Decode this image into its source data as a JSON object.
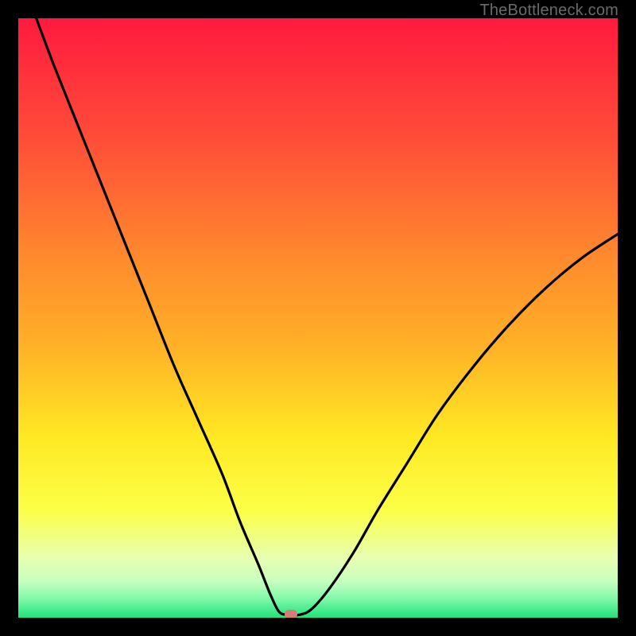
{
  "watermark": "TheBottleneck.com",
  "colors": {
    "frame": "#000000",
    "curve": "#000000",
    "marker": "#d87b74",
    "gradient_stops": [
      {
        "offset": 0.0,
        "color": "#ff1a3f"
      },
      {
        "offset": 0.2,
        "color": "#ff4d38"
      },
      {
        "offset": 0.4,
        "color": "#ff8a2d"
      },
      {
        "offset": 0.55,
        "color": "#ffb227"
      },
      {
        "offset": 0.7,
        "color": "#ffe924"
      },
      {
        "offset": 0.82,
        "color": "#fcff47"
      },
      {
        "offset": 0.9,
        "color": "#e8ffb0"
      },
      {
        "offset": 0.94,
        "color": "#c6ffc0"
      },
      {
        "offset": 0.97,
        "color": "#7cf7a6"
      },
      {
        "offset": 1.0,
        "color": "#1ee27d"
      }
    ]
  },
  "chart_data": {
    "type": "line",
    "title": "",
    "xlabel": "",
    "ylabel": "",
    "xlim": [
      0,
      100
    ],
    "ylim": [
      0,
      100
    ],
    "series": [
      {
        "name": "bottleneck-curve",
        "x": [
          3,
          6,
          10,
          14,
          18,
          22,
          26,
          30,
          34,
          37,
          40,
          42,
          43.5,
          45,
          47,
          49,
          52,
          56,
          60,
          65,
          70,
          76,
          82,
          88,
          94,
          100
        ],
        "y": [
          100,
          92,
          82,
          72,
          62,
          52,
          42,
          33,
          24,
          16,
          9,
          4,
          1,
          0.5,
          0.5,
          1.5,
          5,
          11,
          18,
          26,
          34,
          42,
          49,
          55,
          60,
          64
        ]
      }
    ],
    "marker": {
      "x": 45.5,
      "y": 0.5
    },
    "flat_bottom_range": [
      43.5,
      47
    ]
  }
}
